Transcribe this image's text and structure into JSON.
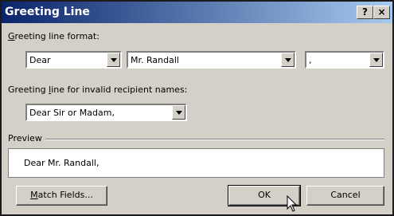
{
  "window": {
    "title": "Greeting Line",
    "help_label": "?",
    "close_label": "×"
  },
  "format": {
    "label_prefix": "",
    "label_mnemonic": "G",
    "label_rest": "reeting line format:",
    "salutation": "Dear",
    "name_format": "Mr. Randall",
    "punctuation": ","
  },
  "invalid": {
    "label_pre": "Greeting ",
    "label_mnemonic": "l",
    "label_rest": "ine for invalid recipient names:",
    "value": "Dear Sir or Madam,"
  },
  "preview": {
    "label": "Preview",
    "text": "Dear Mr. Randall,"
  },
  "buttons": {
    "match_mnemonic": "M",
    "match_rest": "atch Fields...",
    "ok": "OK",
    "cancel": "Cancel"
  }
}
